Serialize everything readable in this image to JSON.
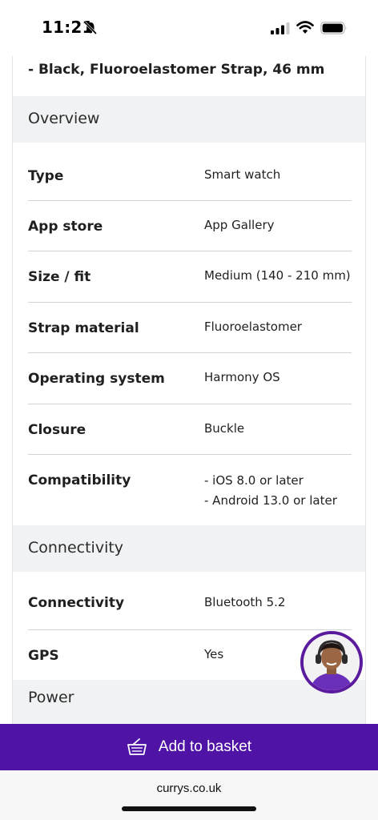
{
  "status_bar": {
    "time": "11:21"
  },
  "product": {
    "name_tail": "- Black, Fluoroelastomer Strap, 46 mm"
  },
  "sections": {
    "overview": "Overview",
    "connectivity": "Connectivity",
    "power": "Power"
  },
  "overview_specs": [
    {
      "label": "Type",
      "value": "Smart watch"
    },
    {
      "label": "App store",
      "value": "App Gallery"
    },
    {
      "label": "Size / fit",
      "value": "Medium (140 - 210 mm)"
    },
    {
      "label": "Strap material",
      "value": "Fluoroelastomer"
    },
    {
      "label": "Operating system",
      "value": "Harmony OS"
    },
    {
      "label": "Closure",
      "value": "Buckle"
    },
    {
      "label": "Compatibility",
      "value_lines": [
        "- iOS 8.0 or later",
        "- Android 13.0 or later"
      ]
    }
  ],
  "connectivity_specs": [
    {
      "label": "Connectivity",
      "value": "Bluetooth 5.2"
    },
    {
      "label": "GPS",
      "value": "Yes"
    }
  ],
  "basket": {
    "label": "Add to basket"
  },
  "browser": {
    "url": "currys.co.uk"
  },
  "colors": {
    "brand_purple": "#4f14a5",
    "section_bg": "#f1f2f3",
    "divider": "#cfd4d6"
  }
}
